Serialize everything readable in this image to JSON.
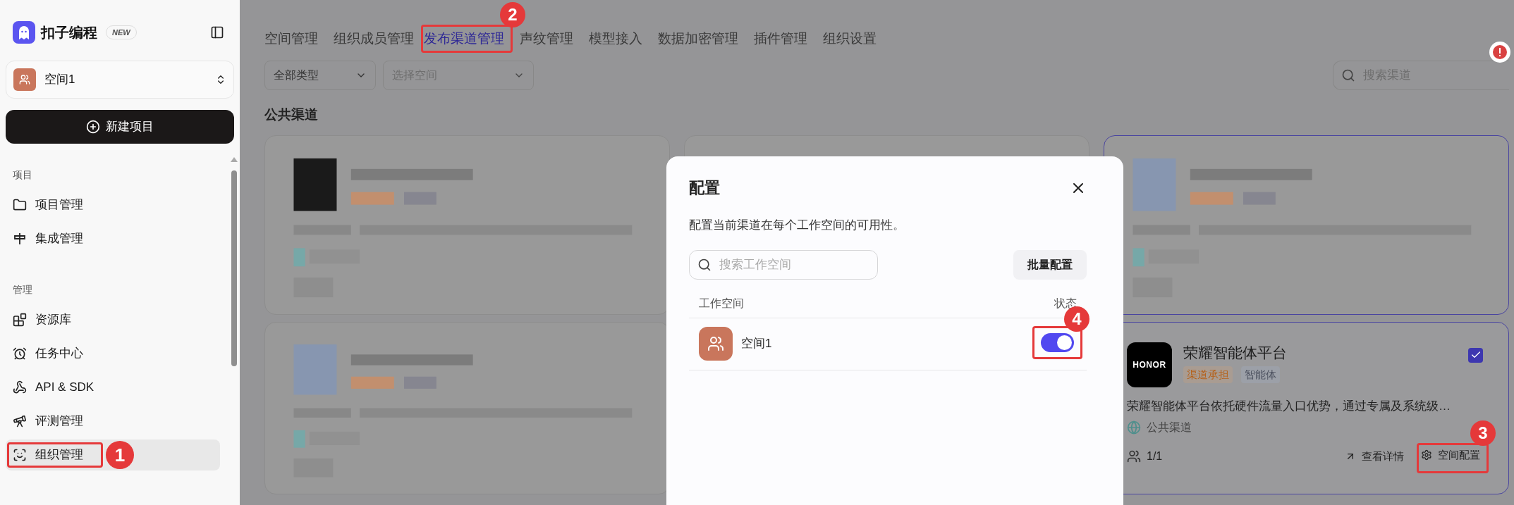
{
  "sidebar": {
    "brand": "扣子编程",
    "badge": "NEW",
    "space": "空间1",
    "new_button": "新建项目",
    "sections": [
      {
        "title": "项目",
        "items": [
          {
            "label": "项目管理",
            "selected": false
          },
          {
            "label": "集成管理",
            "selected": false
          }
        ]
      },
      {
        "title": "管理",
        "items": [
          {
            "label": "资源库",
            "selected": false
          },
          {
            "label": "任务中心",
            "selected": false
          },
          {
            "label": "API & SDK",
            "selected": false
          },
          {
            "label": "评测管理",
            "selected": false
          },
          {
            "label": "组织管理",
            "selected": true,
            "marker": "1"
          }
        ]
      }
    ]
  },
  "tabs": [
    {
      "label": "空间管理",
      "selected": false
    },
    {
      "label": "组织成员管理",
      "selected": false
    },
    {
      "label": "发布渠道管理",
      "selected": true,
      "marker": "2"
    },
    {
      "label": "声纹管理",
      "selected": false
    },
    {
      "label": "模型接入",
      "selected": false
    },
    {
      "label": "数据加密管理",
      "selected": false
    },
    {
      "label": "插件管理",
      "selected": false
    },
    {
      "label": "组织设置",
      "selected": false
    }
  ],
  "filters": [
    {
      "value": "全部类型"
    },
    {
      "placeholder": "选择空间"
    }
  ],
  "search": {
    "placeholder": "搜索渠道"
  },
  "section_title": "公共渠道",
  "channel_card": {
    "logo": "HONOR",
    "title": "荣耀智能体平台",
    "checked": true,
    "tags": [
      {
        "label": "渠道承担",
        "kind": "orange"
      },
      {
        "label": "智能体",
        "kind": "gray"
      }
    ],
    "description": "荣耀智能体平台依托硬件流量入口优势，通过专属及系统级…",
    "scope": "公共渠道",
    "count": "1/1",
    "details_link": "查看详情",
    "config_button": {
      "label": "空间配置",
      "marker": "3"
    }
  },
  "dialog": {
    "title": "配置",
    "description": "配置当前渠道在每个工作空间的可用性。",
    "search": {
      "placeholder": "搜索工作空间"
    },
    "batch_button": "批量配置",
    "columns": [
      "工作空间",
      "状态"
    ],
    "rows": [
      {
        "name": "空间1",
        "on": true,
        "marker": "4"
      }
    ]
  }
}
